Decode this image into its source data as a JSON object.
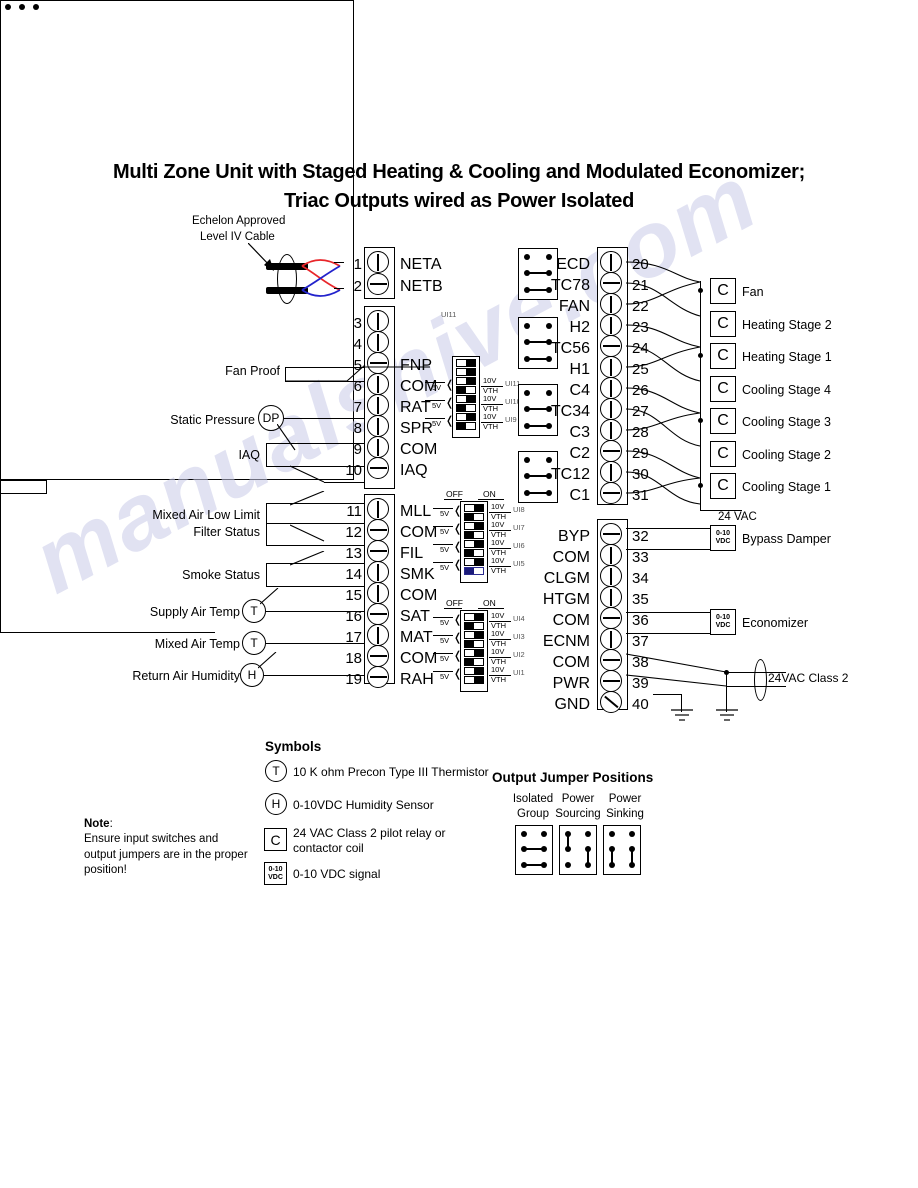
{
  "title": {
    "line1": "Multi Zone Unit with Staged Heating & Cooling and Modulated Economizer;",
    "line2": "Triac Outputs wired as Power Isolated"
  },
  "watermark": "manualshive.com",
  "cable": {
    "label_line1": "Echelon Approved",
    "label_line2": "Level IV Cable"
  },
  "inputs": {
    "left_labels": [
      {
        "name": "fan-proof",
        "text": "Fan Proof"
      },
      {
        "name": "static-pressure",
        "text": "Static Pressure",
        "symbol": "DP"
      },
      {
        "name": "iaq",
        "text": "IAQ"
      },
      {
        "name": "mixed-air-low-limit",
        "text": "Mixed Air Low Limit"
      },
      {
        "name": "filter-status",
        "text": "Filter Status"
      },
      {
        "name": "smoke-status",
        "text": "Smoke Status"
      },
      {
        "name": "supply-air-temp",
        "text": "Supply Air Temp",
        "symbol": "T"
      },
      {
        "name": "mixed-air-temp",
        "text": "Mixed Air Temp",
        "symbol": "T"
      },
      {
        "name": "return-air-humidity",
        "text": "Return Air Humidity",
        "symbol": "H"
      }
    ]
  },
  "terminals_left": [
    {
      "num": "1",
      "label": "NETA"
    },
    {
      "num": "2",
      "label": "NETB"
    },
    {
      "num": "3",
      "label": ""
    },
    {
      "num": "4",
      "label": ""
    },
    {
      "num": "5",
      "label": "FNP"
    },
    {
      "num": "6",
      "label": "COM"
    },
    {
      "num": "7",
      "label": "RAT"
    },
    {
      "num": "8",
      "label": "SPR"
    },
    {
      "num": "9",
      "label": "COM"
    },
    {
      "num": "10",
      "label": "IAQ"
    },
    {
      "num": "11",
      "label": "MLL"
    },
    {
      "num": "12",
      "label": "COM"
    },
    {
      "num": "13",
      "label": "FIL"
    },
    {
      "num": "14",
      "label": "SMK"
    },
    {
      "num": "15",
      "label": "COM"
    },
    {
      "num": "16",
      "label": "SAT"
    },
    {
      "num": "17",
      "label": "MAT"
    },
    {
      "num": "18",
      "label": "COM"
    },
    {
      "num": "19",
      "label": "RAH"
    }
  ],
  "terminals_right_top": [
    {
      "num": "20",
      "label": "ECD"
    },
    {
      "num": "21",
      "label": "TC78"
    },
    {
      "num": "22",
      "label": "FAN"
    },
    {
      "num": "23",
      "label": "H2"
    },
    {
      "num": "24",
      "label": "TC56"
    },
    {
      "num": "25",
      "label": "H1"
    },
    {
      "num": "26",
      "label": "C4"
    },
    {
      "num": "27",
      "label": "TC34"
    },
    {
      "num": "28",
      "label": "C3"
    },
    {
      "num": "29",
      "label": "C2"
    },
    {
      "num": "30",
      "label": "TC12"
    },
    {
      "num": "31",
      "label": "C1"
    }
  ],
  "terminals_right_bottom": [
    {
      "num": "32",
      "label": "BYP"
    },
    {
      "num": "33",
      "label": "COM"
    },
    {
      "num": "34",
      "label": "CLGM"
    },
    {
      "num": "35",
      "label": "HTGM"
    },
    {
      "num": "36",
      "label": "COM"
    },
    {
      "num": "37",
      "label": "ECNM"
    },
    {
      "num": "38",
      "label": "COM"
    },
    {
      "num": "39",
      "label": "PWR"
    },
    {
      "num": "40",
      "label": "GND"
    }
  ],
  "loads": [
    {
      "name": "fan",
      "symbol": "C",
      "text": "Fan"
    },
    {
      "name": "heating-stage-2",
      "symbol": "C",
      "text": "Heating Stage 2"
    },
    {
      "name": "heating-stage-1",
      "symbol": "C",
      "text": "Heating Stage 1"
    },
    {
      "name": "cooling-stage-4",
      "symbol": "C",
      "text": "Cooling Stage 4"
    },
    {
      "name": "cooling-stage-3",
      "symbol": "C",
      "text": "Cooling Stage 3"
    },
    {
      "name": "cooling-stage-2",
      "symbol": "C",
      "text": "Cooling Stage 2"
    },
    {
      "name": "cooling-stage-1",
      "symbol": "C",
      "text": "Cooling Stage 1"
    }
  ],
  "power_labels": {
    "vac_24": "24 VAC",
    "class2": "24VAC Class 2"
  },
  "analog_outputs": [
    {
      "name": "bypass-damper",
      "symbol_line1": "0-10",
      "symbol_line2": "VDC",
      "text": "Bypass Damper"
    },
    {
      "name": "economizer",
      "symbol_line1": "0-10",
      "symbol_line2": "VDC",
      "text": "Economizer"
    }
  ],
  "dip_switches": {
    "off_label": "OFF",
    "on_label": "ON",
    "v5": "5V",
    "v10": "10V",
    "vth": "VTH",
    "group1": [
      {
        "ui": "UI11",
        "selected": false
      },
      {
        "ui": "UI10",
        "selected": false
      },
      {
        "ui": "UI9",
        "selected": false
      }
    ],
    "group2": [
      {
        "ui": "UI8",
        "selected": false
      },
      {
        "ui": "UI7",
        "selected": false
      },
      {
        "ui": "UI6",
        "selected": false
      },
      {
        "ui": "UI5",
        "selected": true
      }
    ],
    "group3": [
      {
        "ui": "UI4",
        "selected": false
      },
      {
        "ui": "UI3",
        "selected": false
      },
      {
        "ui": "UI2",
        "selected": false
      },
      {
        "ui": "UI1",
        "selected": false
      }
    ],
    "ui11_header": "UI11"
  },
  "triac_jumpers": [
    {
      "name": "jumper-tc78",
      "label": "TC78"
    },
    {
      "name": "jumper-tc56",
      "label": "TC56"
    },
    {
      "name": "jumper-tc34",
      "label": "TC34"
    },
    {
      "name": "jumper-tc12",
      "label": "TC12"
    }
  ],
  "symbols": {
    "heading": "Symbols",
    "items": [
      {
        "glyph": "T",
        "shape": "circle",
        "text": "10 K ohm Precon Type III Thermistor"
      },
      {
        "glyph": "H",
        "shape": "circle",
        "text": "0-10VDC Humidity Sensor"
      },
      {
        "glyph": "C",
        "shape": "square",
        "text_line1": "24 VAC Class 2 pilot relay or",
        "text_line2": "contactor coil"
      },
      {
        "glyph": "0-10 VDC",
        "shape": "square-small",
        "text": "0-10 VDC signal"
      }
    ]
  },
  "output_jumper_positions": {
    "heading": "Output Jumper Positions",
    "columns": [
      {
        "name": "isolated-group",
        "line1": "Isolated",
        "line2": "Group"
      },
      {
        "name": "power-sourcing",
        "line1": "Power",
        "line2": "Sourcing"
      },
      {
        "name": "power-sinking",
        "line1": "Power",
        "line2": "Sinking"
      }
    ]
  },
  "note": {
    "heading": "Note",
    "colon": ":",
    "line1": "Ensure input switches and",
    "line2": "output jumpers are in the proper",
    "line3": "position!"
  },
  "colors": {
    "wire_red": "#e8262a",
    "wire_blue": "#2222cc",
    "ink": "#000000",
    "watermark": "#c9cbe8"
  }
}
